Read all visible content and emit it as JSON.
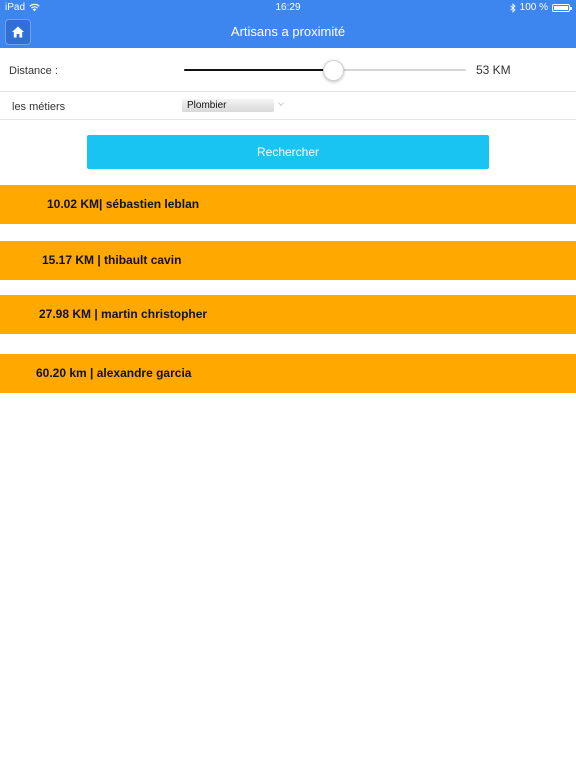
{
  "status_bar": {
    "device": "iPad",
    "time": "16:29",
    "battery": "100 %"
  },
  "nav": {
    "title": "Artisans a proximité"
  },
  "filters": {
    "distance_label": "Distance :",
    "distance_value": "53 KM",
    "distance_slider_fraction": 0.53,
    "metiers_label": "les métiers",
    "metier_selected": "Plombier"
  },
  "search_button": "Rechercher",
  "results": [
    {
      "text": "10.02 KM| sébastien leblan"
    },
    {
      "text": "15.17 KM  | thibault cavin"
    },
    {
      "text": "27.98 KM  | martin christopher"
    },
    {
      "text": "60.20 km  | alexandre garcia"
    }
  ],
  "colors": {
    "header": "#3e86ef",
    "button": "#1ac4f2",
    "result": "#ffa800"
  }
}
